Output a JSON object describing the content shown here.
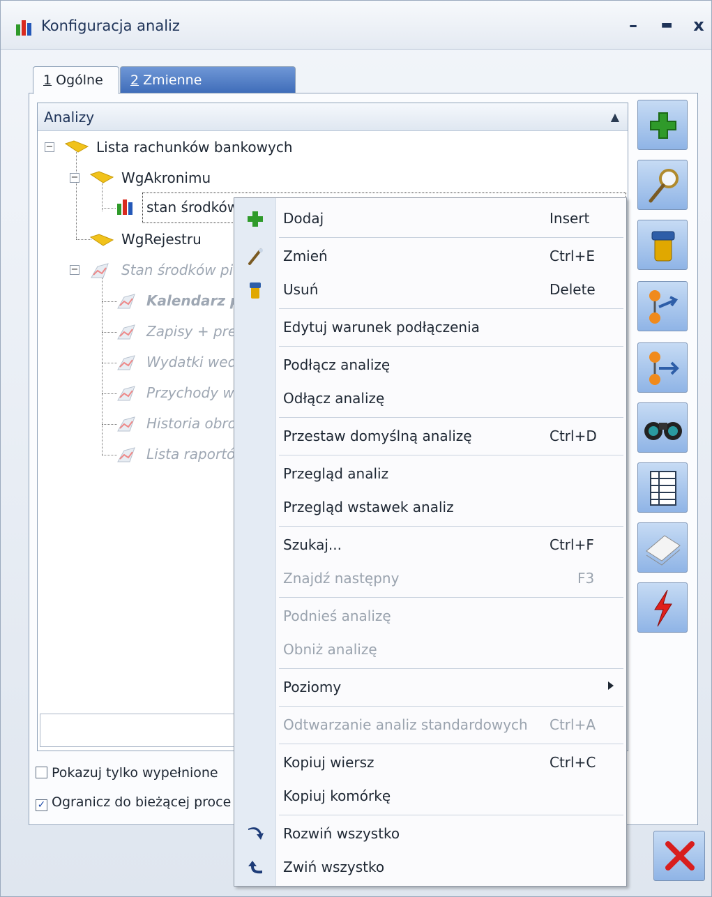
{
  "window": {
    "title": "Konfiguracja analiz",
    "minimize_glyph": "–",
    "maximize_glyph": "▬",
    "close_glyph": "x"
  },
  "tabs": [
    {
      "hotkey": "1",
      "label": " Ogólne"
    },
    {
      "hotkey": "2",
      "label": " Zmienne dynamiczne"
    }
  ],
  "tree": {
    "header": "Analizy",
    "nodes": {
      "root": "Lista rachunków bankowych",
      "wgakronimu": "WgAkronimu",
      "stan": "stan środków",
      "wgrejestru": "WgRejestru",
      "stan_pien": "Stan środków pie",
      "kalendarz": "Kalendarz p",
      "zapisy": "Zapisy + pre",
      "wydatki": "Wydatki wed",
      "przychody": "Przychody w",
      "historia": "Historia obro",
      "lista": "Lista raportó"
    }
  },
  "checkboxes": {
    "only_filled": {
      "label": "Pokazuj tylko wypełnione",
      "checked": false
    },
    "limit_proc": {
      "label": "Ogranicz do bieżącej proce",
      "checked": true,
      "mark": "✓"
    }
  },
  "toolbar_icons": [
    "add-icon",
    "edit-magnifier-icon",
    "delete-trash-icon",
    "connect-icon",
    "disconnect-icon",
    "binoculars-icon",
    "table-icon",
    "pages-icon",
    "lightning-icon"
  ],
  "context_menu": {
    "items": [
      {
        "label": "Dodaj",
        "shortcut": "Insert",
        "icon": "add-icon"
      },
      {
        "label": "Zmień",
        "shortcut": "Ctrl+E",
        "icon": "pencil-icon"
      },
      {
        "label": "Usuń",
        "shortcut": "Delete",
        "icon": "trash-icon"
      },
      {
        "label": "Edytuj warunek podłączenia",
        "shortcut": ""
      },
      {
        "label": "Podłącz analizę",
        "shortcut": ""
      },
      {
        "label": "Odłącz analizę",
        "shortcut": ""
      },
      {
        "label": "Przestaw domyślną analizę",
        "shortcut": "Ctrl+D"
      },
      {
        "label": "Przegląd analiz",
        "shortcut": ""
      },
      {
        "label": "Przegląd wstawek analiz",
        "shortcut": ""
      },
      {
        "label": "Szukaj...",
        "shortcut": "Ctrl+F"
      },
      {
        "label": "Znajdź następny",
        "shortcut": "F3",
        "disabled": true
      },
      {
        "label": "Podnieś analizę",
        "shortcut": "",
        "disabled": true
      },
      {
        "label": "Obniż analizę",
        "shortcut": "",
        "disabled": true
      },
      {
        "label": "Poziomy",
        "shortcut": "",
        "submenu": true
      },
      {
        "label": "Odtwarzanie analiz standardowych",
        "shortcut": "Ctrl+A",
        "disabled": true
      },
      {
        "label": "Kopiuj wiersz",
        "shortcut": "Ctrl+C"
      },
      {
        "label": "Kopiuj komórkę",
        "shortcut": ""
      },
      {
        "label": "Rozwiń wszystko",
        "shortcut": "",
        "icon": "expand-arrow-icon"
      },
      {
        "label": "Zwiń wszystko",
        "shortcut": "",
        "icon": "collapse-arrow-icon"
      }
    ]
  },
  "colors": {
    "accent_blue": "#3d6bb8",
    "add_green": "#2f9a2a",
    "close_red": "#d81e1e",
    "disabled_text": "#9aa3ae"
  }
}
